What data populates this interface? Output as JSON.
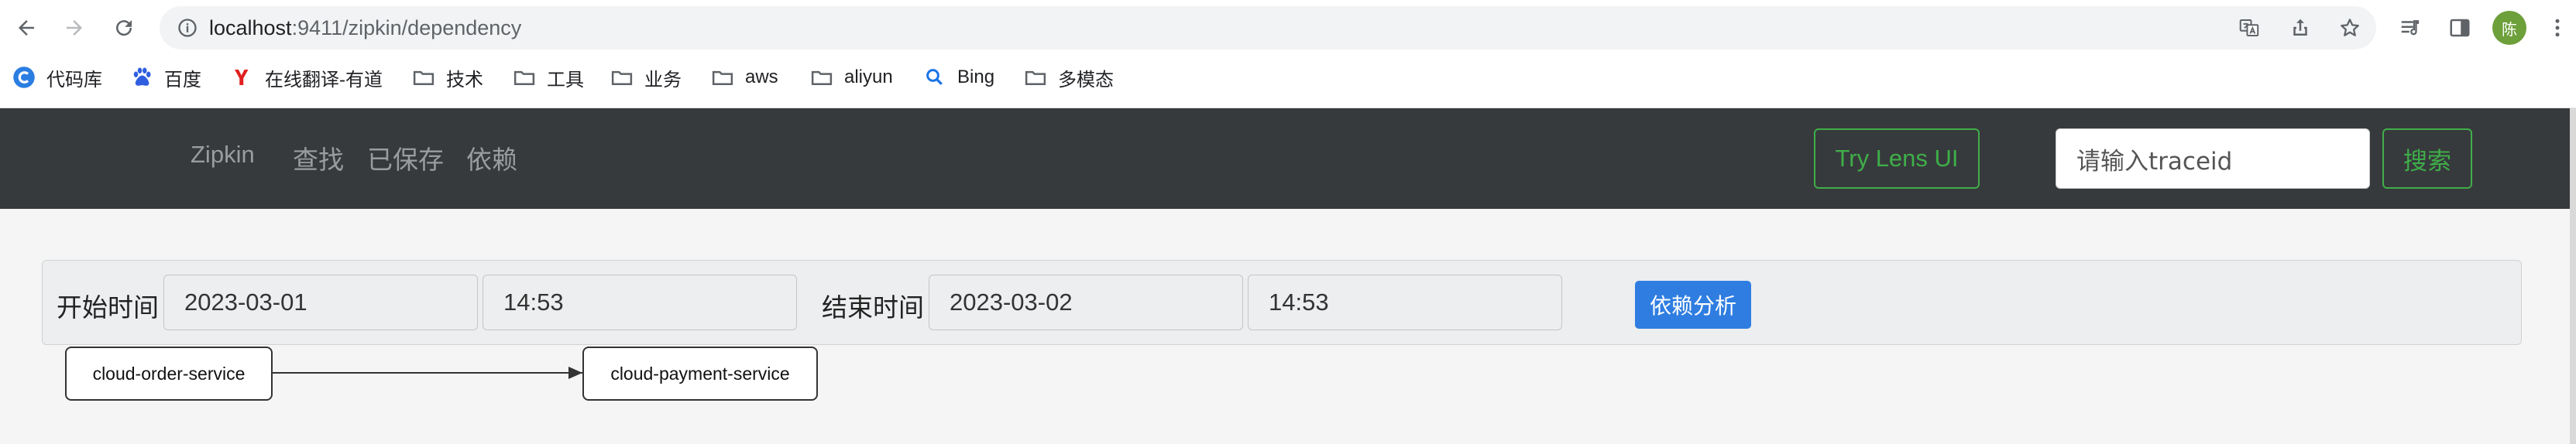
{
  "browser": {
    "url_host": "localhost",
    "url_path": ":9411/zipkin/dependency",
    "avatar_text": "陈",
    "icons": {
      "back": "back-arrow-icon",
      "forward": "forward-arrow-icon",
      "reload": "reload-icon",
      "site_info": "info-icon",
      "translate": "translate-icon",
      "share": "share-icon",
      "bookmark_star": "star-icon",
      "reading_list": "reading-list-icon",
      "side_panel": "side-panel-icon",
      "menu": "more-vert-icon"
    }
  },
  "bookmarks": [
    {
      "label": "代码库",
      "icon": "codebase-icon"
    },
    {
      "label": "百度",
      "icon": "baidu-paw-icon"
    },
    {
      "label": "在线翻译-有道",
      "icon": "youdao-icon"
    },
    {
      "label": "技术",
      "icon": "folder-icon"
    },
    {
      "label": "工具",
      "icon": "folder-icon"
    },
    {
      "label": "业务",
      "icon": "folder-icon"
    },
    {
      "label": "aws",
      "icon": "folder-icon"
    },
    {
      "label": "aliyun",
      "icon": "folder-icon"
    },
    {
      "label": "Bing",
      "icon": "search-icon"
    },
    {
      "label": "多模态",
      "icon": "folder-icon"
    }
  ],
  "navbar": {
    "brand": "Zipkin",
    "links": [
      "查找",
      "已保存",
      "依赖"
    ],
    "try_lens": "Try Lens UI",
    "trace_placeholder": "请输入traceid",
    "search_label": "搜索"
  },
  "filter": {
    "start_label": "开始时间",
    "start_date": "2023-03-01",
    "start_time": "14:53",
    "end_label": "结束时间",
    "end_date": "2023-03-02",
    "end_time": "14:53",
    "analyze_label": "依赖分析"
  },
  "graph": {
    "nodes": [
      "cloud-order-service",
      "cloud-payment-service"
    ],
    "edges": [
      {
        "from": "cloud-order-service",
        "to": "cloud-payment-service"
      }
    ]
  },
  "colors": {
    "navbar_bg": "#373a3c",
    "accent_green": "#3fae49",
    "primary_blue": "#2f7de1"
  }
}
